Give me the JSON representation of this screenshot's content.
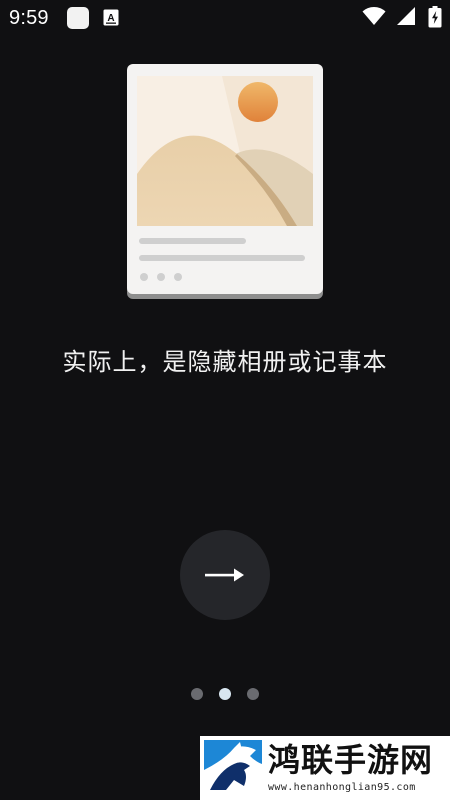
{
  "status_bar": {
    "time": "9:59",
    "icons": [
      "app-notification-icon",
      "text-notification-icon",
      "wifi-icon",
      "cellular-signal-icon",
      "battery-icon"
    ]
  },
  "onboarding": {
    "headline": "实际上，是隐藏相册或记事本",
    "next_button_icon": "arrow-right-icon",
    "page_indicator": {
      "total": 3,
      "current": 2
    }
  },
  "watermark": {
    "title": "鸿联手游网",
    "url": "www.henanhonglian95.com"
  },
  "colors": {
    "background": "#101012",
    "button": "#25262a",
    "dot_active": "#d8e6f0",
    "dot_inactive": "#6a6b70"
  }
}
